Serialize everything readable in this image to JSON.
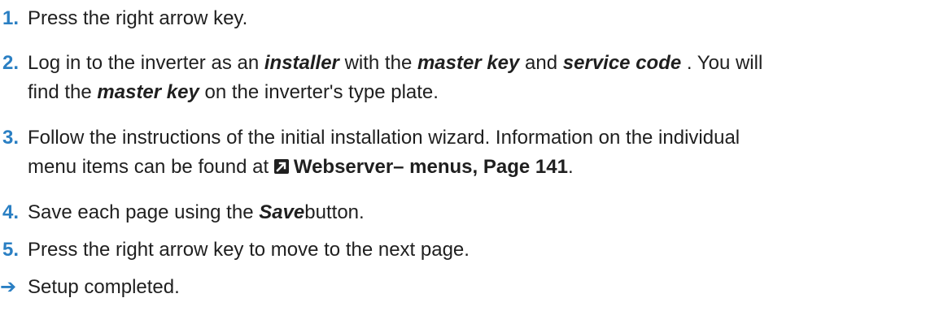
{
  "steps": [
    {
      "number": "1.",
      "text": "Press the right arrow key."
    },
    {
      "number": "2.",
      "t1": "Log in to the inverter as an ",
      "e1": "installer",
      "t2": " with the ",
      "e2": "master key",
      "t3": " and ",
      "e3": "service code",
      "t4": " . You will",
      "t5": "find the ",
      "e4": "master key",
      "t6": " on the inverter's type plate."
    },
    {
      "number": "3.",
      "t1": "Follow the instructions of the initial installation wizard. Information on the individual",
      "t2": "menu items can be found at ",
      "link": "Webserver– menus, Page 141",
      "t3": "."
    },
    {
      "number": "4.",
      "t1": "Save each page using the ",
      "e1": "Save",
      "t2": "button."
    },
    {
      "number": "5.",
      "text": "Press the right arrow key to move to the next page."
    }
  ],
  "result": {
    "arrow": "➔",
    "text": "Setup completed."
  },
  "colors": {
    "accent": "#2a7fc3",
    "text": "#1f1f1f"
  },
  "icons": {
    "link": "link-arrow-icon"
  }
}
